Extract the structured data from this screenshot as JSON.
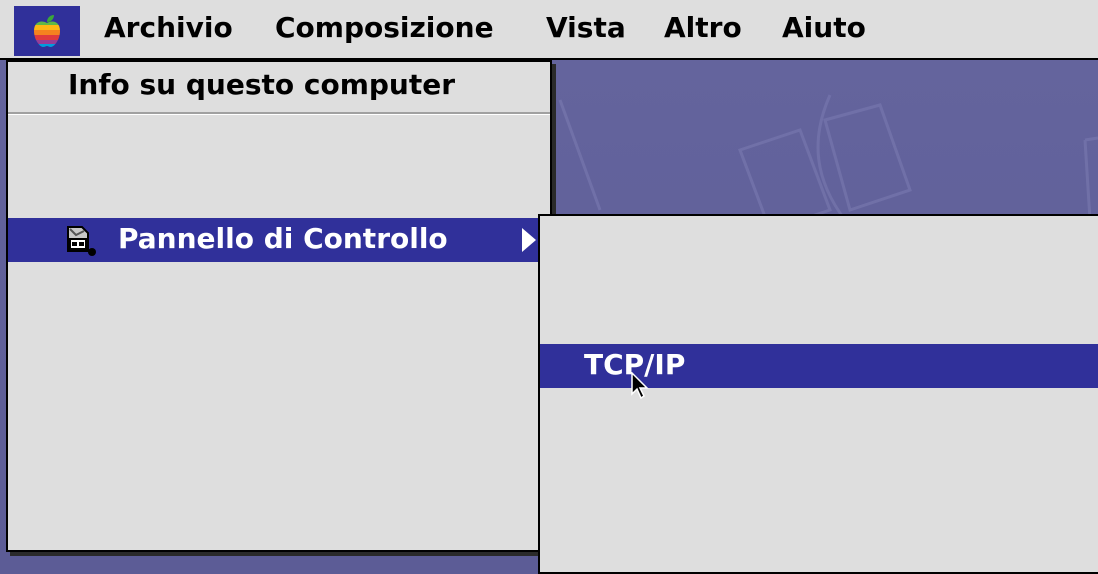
{
  "menubar": {
    "apple_icon": "apple-rainbow-icon",
    "menus": [
      "Archivio",
      "Composizione",
      "Vista",
      "Altro",
      "Aiuto"
    ]
  },
  "apple_menu": {
    "items": [
      {
        "label": "Info su questo computer"
      },
      {
        "label": "Pannello di Controllo",
        "icon": "control-panel-icon",
        "has_submenu": true,
        "selected": true
      }
    ]
  },
  "submenu": {
    "items": [
      {
        "label": "TCP/IP",
        "selected": true
      }
    ]
  },
  "colors": {
    "menu_background": "#dedede",
    "highlight": "#30309a",
    "desktop": "#5f5f99"
  }
}
